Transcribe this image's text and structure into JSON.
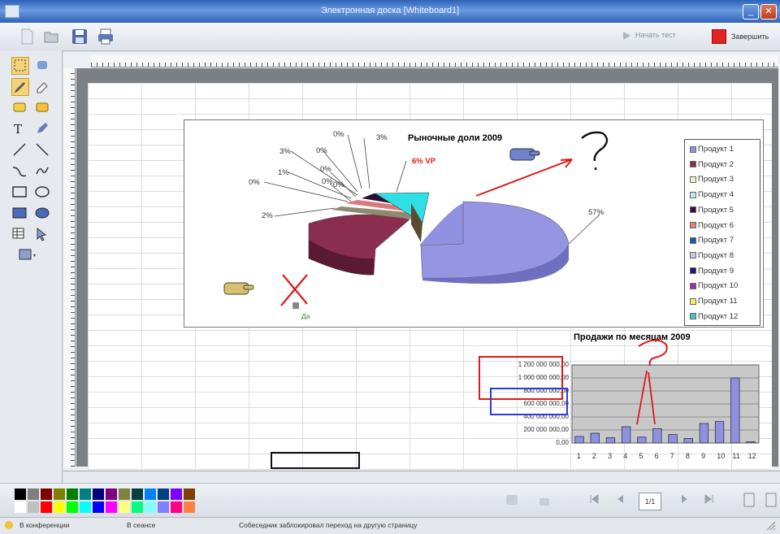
{
  "window": {
    "title": "Электронная доска [Whiteboard1]"
  },
  "toolbar": {
    "start_test": "Начать тест",
    "stop_label": "Завершить"
  },
  "pie_chart": {
    "title": "Рыночные доли 2009",
    "slice_labels": [
      "57%",
      "0%",
      "3%",
      "3%",
      "0%",
      "1%",
      "0%",
      "0%",
      "2%",
      "0%",
      "0%"
    ],
    "callout": "6% VP",
    "legend": [
      "Продукт 1",
      "Продукт 2",
      "Продукт 3",
      "Продукт 4",
      "Продукт 5",
      "Продукт 6",
      "Продукт 7",
      "Продукт 8",
      "Продукт 9",
      "Продукт 10",
      "Продукт 11",
      "Продукт 12"
    ],
    "legend_colors": [
      "#8f90e0",
      "#8a2d4e",
      "#f2f2c8",
      "#bfe8f2",
      "#3a1040",
      "#e08080",
      "#1a5ab4",
      "#c8c8ea",
      "#1a1a6e",
      "#a030b0",
      "#f0f060",
      "#40c8c8"
    ]
  },
  "chart_data": {
    "type": "bar",
    "title": "Продажи по месяцам 2009",
    "categories": [
      "1",
      "2",
      "3",
      "4",
      "5",
      "6",
      "7",
      "8",
      "9",
      "10",
      "11",
      "12"
    ],
    "values": [
      100000000,
      150000000,
      80000000,
      250000000,
      90000000,
      220000000,
      130000000,
      70000000,
      300000000,
      330000000,
      1000000000,
      20000000
    ],
    "ylim": [
      0,
      1200000000
    ],
    "ytick_labels": [
      "1 200 000 000,00",
      "1 000 000 000,00",
      "800 000 000,00",
      "600 000 000,00",
      "400 000 000,00",
      "200 000 000,00",
      "0,00"
    ],
    "bar_color": "#8f90e0"
  },
  "annotations": {
    "da_label": "Да"
  },
  "pager": {
    "current": "1/1"
  },
  "status": {
    "conference": "В конференции",
    "session": "В сеансе",
    "message": "Собеседник заблокировал переход на другую страницу"
  },
  "palette": [
    "#000000",
    "#7f7f7f",
    "#800000",
    "#808000",
    "#008000",
    "#008080",
    "#000080",
    "#800080",
    "#808040",
    "#004040",
    "#0080ff",
    "#004080",
    "#8000ff",
    "#804000",
    "#ffffff",
    "#c0c0c0",
    "#ff0000",
    "#ffff00",
    "#00ff00",
    "#00ffff",
    "#0000ff",
    "#ff00ff",
    "#ffff80",
    "#00ff80",
    "#80ffff",
    "#8080ff",
    "#ff0080",
    "#ff8040"
  ]
}
